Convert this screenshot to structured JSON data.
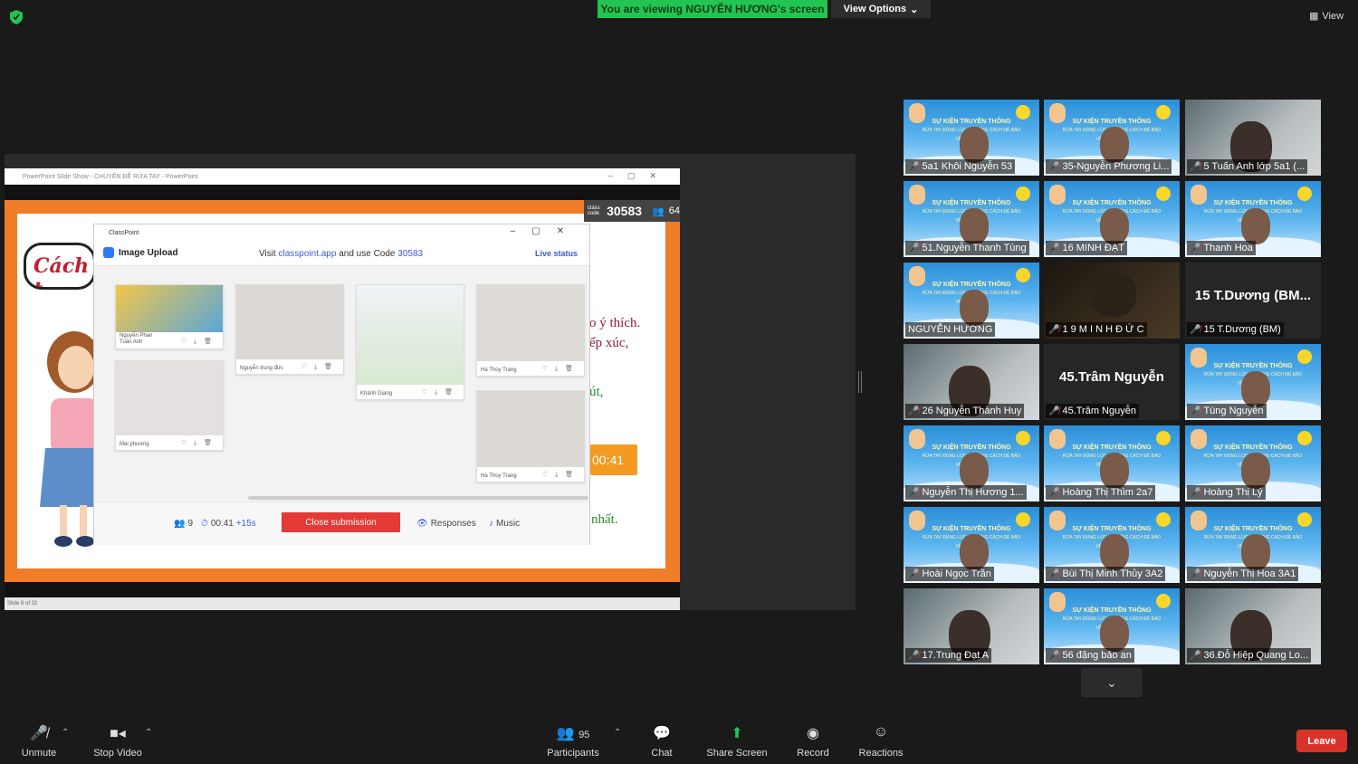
{
  "banner": {
    "text": "You are viewing NGUYỄN HƯƠNG's screen",
    "view_options": "View Options"
  },
  "top_right": {
    "view": "View"
  },
  "ppt": {
    "title": "PowerPoint Slide Show  -  CHUYÊN ĐỀ RỬA TAY  -  PowerPoint",
    "status": "Slide 6 of 32",
    "class_code_label": "class code",
    "class_code": "30583",
    "participants": "64",
    "slide_logo": "Cách t",
    "slide_lines": [
      "o ý thích.",
      "ếp xúc,",
      "út,",
      "nhất."
    ],
    "slide_timer": "00:41"
  },
  "classpoint": {
    "title": "ClassPoint",
    "tab": "Image Upload",
    "visit_prefix": "Visit ",
    "visit_link": "classpoint.app",
    "visit_mid": " and use Code ",
    "visit_code": "30583",
    "live_status": "Live status",
    "count": "9",
    "timer": "00:41",
    "timer_extra": "+15s",
    "close_submission": "Close submission",
    "responses": "Responses",
    "music": "Music",
    "cards": [
      {
        "name": "Nguyễn Phan Tuấn Anh"
      },
      {
        "name": "Mai phương"
      },
      {
        "name": "Nguyễn trung đức"
      },
      {
        "name": "Khánh Giang"
      },
      {
        "name": "Hà Thùy Trang"
      },
      {
        "name": "Hà Thùy Trang"
      }
    ]
  },
  "gallery": [
    {
      "name": "5a1 Khôi Nguyễn 53",
      "type": "poster"
    },
    {
      "name": "35-Nguyễn Phương Li...",
      "type": "poster"
    },
    {
      "name": "5 Tuấn Anh lớp 5a1 (...",
      "type": "cam"
    },
    {
      "name": "51.Nguyễn Thanh Tùng",
      "type": "poster"
    },
    {
      "name": "16 MINH ĐẠT",
      "type": "poster"
    },
    {
      "name": "Thanh Hoa",
      "type": "poster"
    },
    {
      "name": "NGUYỄN HƯƠNG",
      "type": "poster",
      "active": true,
      "muted": false
    },
    {
      "name": "1 9 M I N H Đ Ứ C",
      "type": "dark"
    },
    {
      "name": "15 T.Dương (BM)",
      "type": "text",
      "big": "15 T.Dương (BM..."
    },
    {
      "name": "26 Nguyễn Thành Huy",
      "type": "cam"
    },
    {
      "name": "45.Trâm Nguyễn",
      "type": "text",
      "big": "45.Trâm Nguyễn"
    },
    {
      "name": "Tùng Nguyễn",
      "type": "poster"
    },
    {
      "name": "Nguyễn Thị Hương 1...",
      "type": "poster"
    },
    {
      "name": "Hoàng Thị Thìm 2a7",
      "type": "poster"
    },
    {
      "name": "Hoàng Thị Lý",
      "type": "poster"
    },
    {
      "name": "Hoài Ngọc Trần",
      "type": "poster"
    },
    {
      "name": "Bùi Thị Minh Thủy 3A2",
      "type": "poster"
    },
    {
      "name": "Nguyễn Thị Hoa 3A1",
      "type": "poster"
    },
    {
      "name": "17.Trung Đạt A",
      "type": "cam"
    },
    {
      "name": "56 đặng  bảo an",
      "type": "poster"
    },
    {
      "name": "36.Đỗ Hiệp Quang Lo...",
      "type": "cam"
    }
  ],
  "poster_title": "SỰ KIỆN TRUYỀN THÔNG",
  "poster_sub": "RỬA TAY ĐÚNG LÚC VÀ ĐÚNG CÁCH ĐỂ BẢO VỆ SỨC KHOẺ",
  "toolbar": {
    "unmute": "Unmute",
    "stop_video": "Stop Video",
    "participants": "Participants",
    "participants_count": "95",
    "chat": "Chat",
    "share_screen": "Share Screen",
    "record": "Record",
    "reactions": "Reactions",
    "leave": "Leave"
  },
  "colors": {
    "banner": "#23c552",
    "leave": "#d9322b",
    "close_submission": "#e53935",
    "slide_frame": "#f07d27"
  }
}
